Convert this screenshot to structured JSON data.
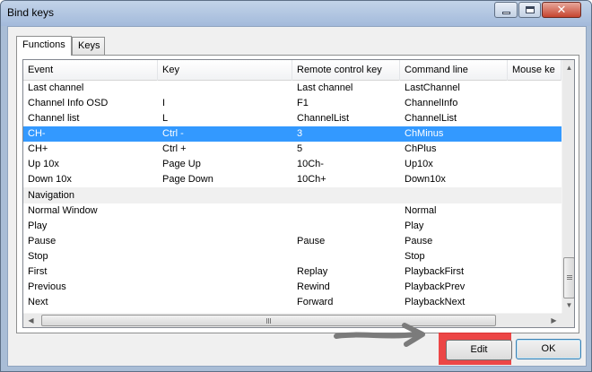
{
  "window": {
    "title": "Bind keys"
  },
  "tabs": [
    {
      "label": "Functions",
      "active": true
    },
    {
      "label": "Keys",
      "active": false
    }
  ],
  "table": {
    "columns": [
      "Event",
      "Key",
      "Remote control key",
      "Command line",
      "Mouse ke"
    ],
    "rows": [
      {
        "event": "Last channel",
        "key": "",
        "remote": "Last channel",
        "command": "LastChannel"
      },
      {
        "event": "Channel Info OSD",
        "key": "I",
        "remote": "F1",
        "command": "ChannelInfo"
      },
      {
        "event": "Channel list",
        "key": "L",
        "remote": "ChannelList",
        "command": "ChannelList"
      },
      {
        "event": "CH-",
        "key": "Ctrl -",
        "remote": "3",
        "command": "ChMinus",
        "selected": true
      },
      {
        "event": "CH+",
        "key": "Ctrl +",
        "remote": "5",
        "command": "ChPlus"
      },
      {
        "event": "Up 10x",
        "key": "Page Up",
        "remote": "10Ch-",
        "command": "Up10x"
      },
      {
        "event": "Down 10x",
        "key": "Page Down",
        "remote": "10Ch+",
        "command": "Down10x"
      },
      {
        "group": "Navigation"
      },
      {
        "event": "Normal Window",
        "key": "",
        "remote": "",
        "command": "Normal"
      },
      {
        "event": "Play",
        "key": "",
        "remote": "",
        "command": "Play"
      },
      {
        "event": "Pause",
        "key": "",
        "remote": "Pause",
        "command": "Pause"
      },
      {
        "event": "Stop",
        "key": "",
        "remote": "",
        "command": "Stop"
      },
      {
        "event": "First",
        "key": "",
        "remote": "Replay",
        "command": "PlaybackFirst"
      },
      {
        "event": "Previous",
        "key": "",
        "remote": "Rewind",
        "command": "PlaybackPrev"
      },
      {
        "event": "Next",
        "key": "",
        "remote": "Forward",
        "command": "PlaybackNext"
      }
    ]
  },
  "buttons": {
    "edit": "Edit",
    "ok": "OK"
  },
  "colors": {
    "selection": "#3399ff",
    "highlight": "#eb2828",
    "window_frame": "#a9bdd6"
  },
  "icons": {
    "minimize": "minimize-icon",
    "maximize": "maximize-icon",
    "close": "close-icon",
    "scroll_up": "chevron-up-icon",
    "scroll_down": "chevron-down-icon",
    "scroll_left": "chevron-left-icon",
    "scroll_right": "chevron-right-icon",
    "annotation": "arrow-right-icon"
  }
}
